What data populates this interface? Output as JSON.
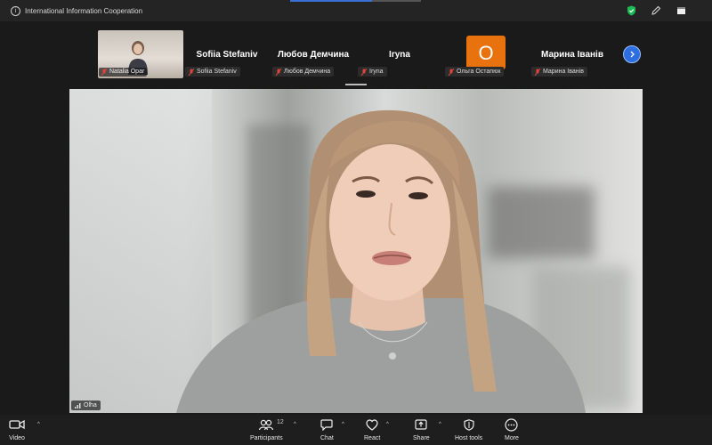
{
  "window": {
    "title": "International Information Cooperation",
    "title_icon": "info-icon",
    "right_icons": [
      "shield-icon",
      "edit-icon",
      "window-icon"
    ]
  },
  "strip": {
    "thumbnails": [
      {
        "type": "video",
        "chip_name": "Natalia Opar"
      },
      {
        "type": "name",
        "display_name": "Sofiia Stefaniv",
        "chip_name": "Sofiia Stefaniv"
      },
      {
        "type": "name",
        "display_name": "Любов Демчина",
        "chip_name": "Любов Демчина"
      },
      {
        "type": "name",
        "display_name": "Iryna",
        "chip_name": "Iryna"
      },
      {
        "type": "avatar",
        "avatar_text": "O",
        "avatar_color": "#e8730e",
        "chip_name": "Ольга Остапюк"
      },
      {
        "type": "name",
        "display_name": "Марина Іванів",
        "chip_name": "Марина Іванів"
      }
    ],
    "next_icon": "chevron-right-icon"
  },
  "main": {
    "speaker_name": "Olha",
    "signal_icon": "signal-bars-icon"
  },
  "toolbar": {
    "video_label": "Video",
    "participants_label": "Participants",
    "participants_count": "12",
    "chat_label": "Chat",
    "react_label": "React",
    "share_label": "Share",
    "host_tools_label": "Host tools",
    "more_label": "More"
  },
  "colors": {
    "accent_blue": "#2d6fe0",
    "avatar_orange": "#e8730e",
    "mute_red": "#e0443a",
    "shield_green": "#1db954"
  }
}
